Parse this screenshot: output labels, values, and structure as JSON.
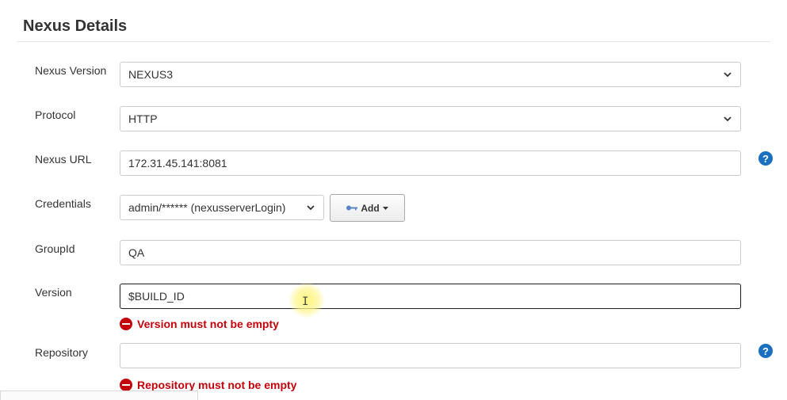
{
  "section": {
    "title": "Nexus Details"
  },
  "fields": {
    "nexus_version": {
      "label": "Nexus Version",
      "value": "NEXUS3"
    },
    "protocol": {
      "label": "Protocol",
      "value": "HTTP"
    },
    "nexus_url": {
      "label": "Nexus URL",
      "value": "172.31.45.141:8081"
    },
    "credentials": {
      "label": "Credentials",
      "value": "admin/****** (nexusserverLogin)",
      "add_label": "Add"
    },
    "group_id": {
      "label": "GroupId",
      "value": "QA"
    },
    "version": {
      "label": "Version",
      "value": "$BUILD_ID",
      "error": "Version must not be empty"
    },
    "repository": {
      "label": "Repository",
      "value": "",
      "error": "Repository must not be empty"
    }
  },
  "icons": {
    "help": "?",
    "ibeam": "I"
  },
  "colors": {
    "error": "#c4000a",
    "help_icon": "#1a6fc1",
    "cursor_highlight": "#fff578"
  }
}
